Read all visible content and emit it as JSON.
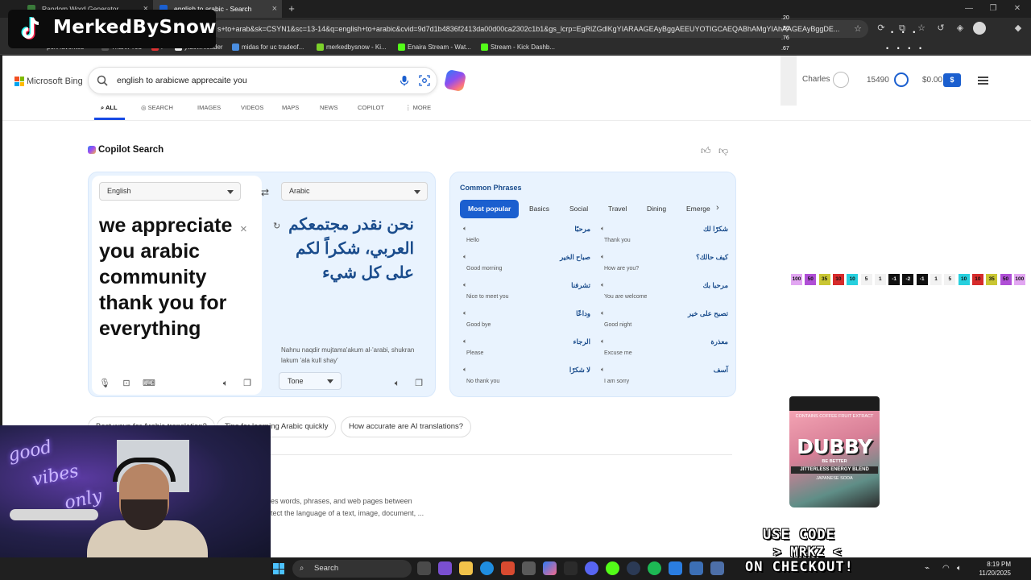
{
  "browser": {
    "tabs": [
      {
        "label": "Random Word Generator"
      },
      {
        "label": "english to arabic - Search"
      }
    ],
    "new_tab": "+",
    "url": "s+to+arab&sk=CSYN1&sc=13-14&q=english+to+arabic&cvid=9d7d1b4836f2413da00d00ca2302c1b1&gs_lcrp=EgRlZGdlKgYIARAAGEAyBggAEEUYOTIGCAEQABhAMgYIAhAAGEAyBggDE...",
    "bookmarks": [
      "port favorites",
      "Thank You",
      "i",
      "ytdownloader",
      "midas for uc tradeof...",
      "merkedbysnow - Ki...",
      "Enaira Stream - Wat...",
      "Stream - Kick Dashb..."
    ]
  },
  "bing": {
    "logo": "Microsoft Bing",
    "query": "english to arabicwe apprecaite you",
    "user_name": "Charles",
    "points": "15490",
    "money": "$0.00",
    "money_icon": "$",
    "nav": [
      "ALL",
      "SEARCH",
      "IMAGES",
      "VIDEOS",
      "MAPS",
      "NEWS",
      "COPILOT",
      "MORE"
    ]
  },
  "copilot": {
    "title": "Copilot Search"
  },
  "translator": {
    "source_lang": "English",
    "target_lang": "Arabic",
    "source_text": "we appreciate you arabic community thank you for everything",
    "target_text": "نحن نقدر مجتمعكم العربي، شكراً لكم على كل شيء",
    "transliteration": "Nahnu naqdir mujtama'akum al-'arabi, shukran lakum 'ala kull shay'",
    "tone_label": "Tone"
  },
  "phrases": {
    "title": "Common Phrases",
    "chips": [
      "Most popular",
      "Basics",
      "Social",
      "Travel",
      "Dining",
      "Emerge"
    ],
    "items": [
      {
        "ar": "مرحبًا",
        "en": "Hello"
      },
      {
        "ar": "شكرًا لك",
        "en": "Thank you"
      },
      {
        "ar": "صباح الخير",
        "en": "Good morning"
      },
      {
        "ar": "كيف حالك؟",
        "en": "How are you?"
      },
      {
        "ar": "تشرفنا",
        "en": "Nice to meet you"
      },
      {
        "ar": "مرحبا بك",
        "en": "You are welcome"
      },
      {
        "ar": "وداعًا",
        "en": "Good bye"
      },
      {
        "ar": "تصبح على خير",
        "en": "Good night"
      },
      {
        "ar": "الرجاء",
        "en": "Please"
      },
      {
        "ar": "معذرة",
        "en": "Excuse me"
      },
      {
        "ar": "لا شكرًا",
        "en": "No thank you"
      },
      {
        "ar": "آسف",
        "en": "I am sorry"
      }
    ]
  },
  "suggestions": [
    "Best ways for Arabic translation?",
    "Tips for learning Arabic quickly",
    "How accurate are AI translations?"
  ],
  "snippet": {
    "line1": "es words, phrases, and web pages between",
    "line2": "tect the language of a text, image, document, ..."
  },
  "overlay": {
    "channel": "MerkedBySnow",
    "stats": [
      ".20",
      ".86",
      ".76",
      ".67"
    ],
    "scoreboard": [
      {
        "v": "100",
        "c": "#e2a6f2"
      },
      {
        "v": "50",
        "c": "#b04fd6"
      },
      {
        "v": "35",
        "c": "#c9c633"
      },
      {
        "v": "10",
        "c": "#d62b2b"
      },
      {
        "v": "10",
        "c": "#27d0de"
      },
      {
        "v": "5",
        "c": "#f2f2f2"
      },
      {
        "v": "1",
        "c": "#f2f2f2"
      },
      {
        "v": "-1",
        "c": "#111111"
      },
      {
        "v": "-2",
        "c": "#111111"
      },
      {
        "v": "-1",
        "c": "#111111"
      },
      {
        "v": "1",
        "c": "#f2f2f2"
      },
      {
        "v": "5",
        "c": "#f2f2f2"
      },
      {
        "v": "10",
        "c": "#27d0de"
      },
      {
        "v": "10",
        "c": "#d62b2b"
      },
      {
        "v": "35",
        "c": "#c9c633"
      },
      {
        "v": "50",
        "c": "#b04fd6"
      },
      {
        "v": "100",
        "c": "#e2a6f2"
      }
    ],
    "can": {
      "top": "CONTAINS COFFEE FRUIT EXTRACT",
      "brand": "DUBBY",
      "sub": "BE BETTER",
      "band": "JITTERLESS ENERGY BLEND",
      "flavor": "JAPANESE SODA"
    },
    "promo_line1": "USE CODE",
    "promo_line2": "> MRKZ <",
    "promo_line3": "ON CHECKOUT!"
  },
  "taskbar": {
    "search": "Search",
    "time": "8:19 PM",
    "date": "11/20/2025"
  }
}
